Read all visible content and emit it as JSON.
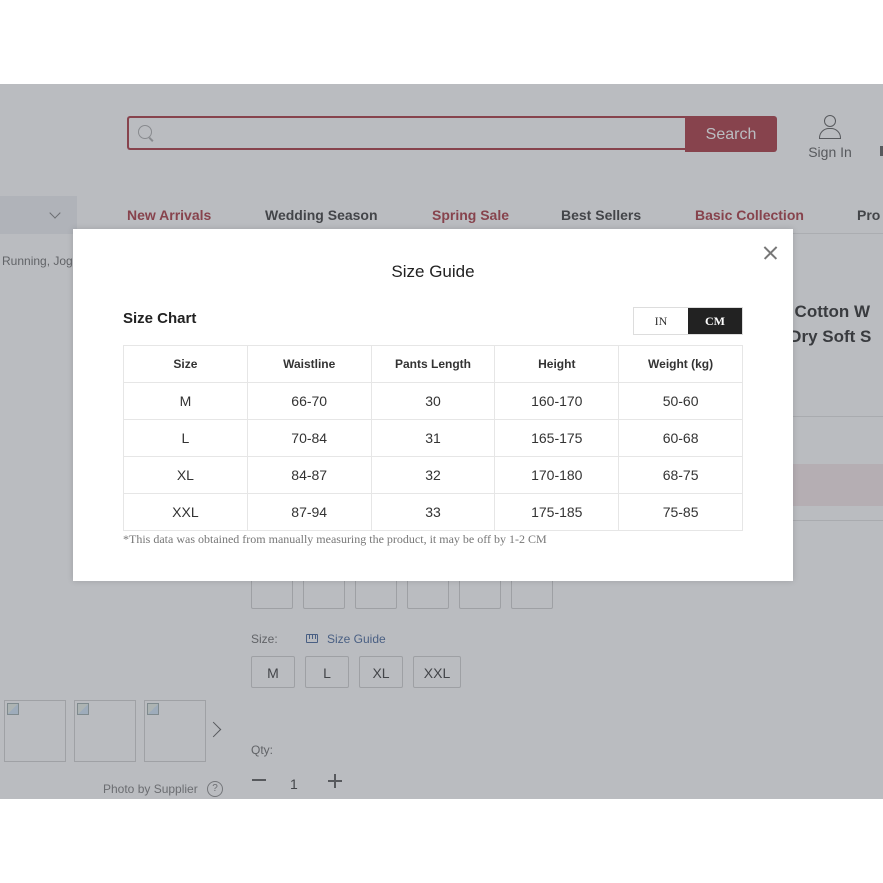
{
  "header": {
    "search_placeholder": "",
    "search_button": "Search",
    "sign_in": "Sign In"
  },
  "nav": {
    "items": [
      {
        "label": "New Arrivals",
        "color": "#a7303a"
      },
      {
        "label": "Wedding Season",
        "color": "#333333"
      },
      {
        "label": "Spring Sale",
        "color": "#a7303a"
      },
      {
        "label": "Best Sellers",
        "color": "#333333"
      },
      {
        "label": "Basic Collection",
        "color": "#a7303a"
      },
      {
        "label": "Pro",
        "color": "#333333"
      }
    ]
  },
  "breadcrumb": "Running, Jog",
  "product_title_fragments": [
    "ns Cotton W",
    "k Dry Soft S"
  ],
  "size_selector": {
    "label": "Size:",
    "guide_link": "Size Guide",
    "options": [
      "M",
      "L",
      "XL",
      "XXL"
    ]
  },
  "gallery": {
    "photo_credit": "Photo by Supplier",
    "help": "?"
  },
  "quantity": {
    "label": "Qty:",
    "value": "1"
  },
  "modal": {
    "title": "Size Guide",
    "chart_heading": "Size Chart",
    "units": {
      "in": "IN",
      "cm": "CM",
      "selected": "CM"
    },
    "columns": [
      "Size",
      "Waistline",
      "Pants Length",
      "Height",
      "Weight (kg)"
    ],
    "rows": [
      [
        "M",
        "66-70",
        "30",
        "160-170",
        "50-60"
      ],
      [
        "L",
        "70-84",
        "31",
        "165-175",
        "60-68"
      ],
      [
        "XL",
        "84-87",
        "32",
        "170-180",
        "68-75"
      ],
      [
        "XXL",
        "87-94",
        "33",
        "175-185",
        "75-85"
      ]
    ],
    "footnote": "*This data was obtained from manually measuring the product, it may be off by 1-2 CM"
  },
  "colors": {
    "brand": "#a7303a",
    "link": "#3d5f96",
    "overlay": "rgba(90,95,105,0.42)"
  }
}
